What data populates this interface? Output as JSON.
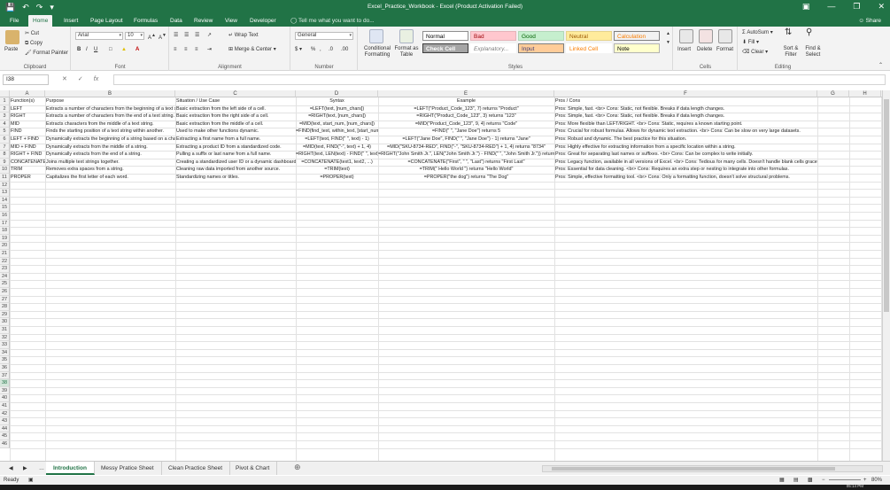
{
  "window": {
    "title": "Excel_Practice_Workbook - Excel (Product Activation Failed)",
    "share": "Share"
  },
  "tabs": [
    "File",
    "Home",
    "Insert",
    "Page Layout",
    "Formulas",
    "Data",
    "Review",
    "View",
    "Developer"
  ],
  "tell_me": "Tell me what you want to do...",
  "ribbon": {
    "clipboard": {
      "label": "Clipboard",
      "paste": "Paste",
      "cut": "Cut",
      "copy": "Copy",
      "format_painter": "Format Painter"
    },
    "font": {
      "label": "Font",
      "family": "Arial",
      "size": "10"
    },
    "alignment": {
      "label": "Alignment",
      "wrap": "Wrap Text",
      "merge": "Merge & Center"
    },
    "number": {
      "label": "Number",
      "format": "General"
    },
    "styles": {
      "label": "Styles",
      "conditional": "Conditional Formatting",
      "format_as_table": "Format as Table",
      "cells": [
        {
          "text": "Normal",
          "bg": "#ffffff",
          "fg": "#000000",
          "border": "#8f8f8f"
        },
        {
          "text": "Bad",
          "bg": "#ffc7ce",
          "fg": "#9c0006",
          "border": "#e6b3b9"
        },
        {
          "text": "Good",
          "bg": "#c6efce",
          "fg": "#006100",
          "border": "#b2d7b9"
        },
        {
          "text": "Neutral",
          "bg": "#ffeb9c",
          "fg": "#9c5700",
          "border": "#e6d38c"
        },
        {
          "text": "Calculation",
          "bg": "#f2f2f2",
          "fg": "#fa7d00",
          "border": "#7f7f7f"
        },
        {
          "text": "Check Cell",
          "bg": "#a5a5a5",
          "fg": "#ffffff",
          "border": "#3f3f3f"
        },
        {
          "text": "Explanatory...",
          "bg": "#ffffff",
          "fg": "#7f7f7f",
          "border": "#ffffff"
        },
        {
          "text": "Input",
          "bg": "#ffcc99",
          "fg": "#3f3f76",
          "border": "#7f7f7f"
        },
        {
          "text": "Linked Cell",
          "bg": "#ffffff",
          "fg": "#fa7d00",
          "border": "#ffffff"
        },
        {
          "text": "Note",
          "bg": "#ffffcc",
          "fg": "#000000",
          "border": "#b2b2b2"
        }
      ]
    },
    "cells": {
      "label": "Cells",
      "insert": "Insert",
      "delete": "Delete",
      "format": "Format"
    },
    "editing": {
      "label": "Editing",
      "autosum": "AutoSum",
      "fill": "Fill",
      "clear": "Clear",
      "sort": "Sort & Filter",
      "find": "Find & Select"
    }
  },
  "formula_bar": {
    "name_box": "I38",
    "fx": "fx",
    "value": ""
  },
  "columns": [
    "A",
    "B",
    "C",
    "D",
    "E",
    "F",
    "G",
    "H"
  ],
  "rows": [
    [
      "Function(s)",
      "Purpose",
      "Situation / Use Case",
      "Syntax",
      "Example",
      "Pros / Cons"
    ],
    [
      "LEFT",
      "Extracts a number of characters from the beginning of a text string.",
      "Basic extraction from the left side of a cell.",
      "=LEFT(text, [num_chars])",
      "=LEFT(\"Product_Code_123\", 7) returns \"Product\"",
      "Pros: Simple, fast. <br> Cons: Static, not flexible. Breaks if data length changes."
    ],
    [
      "RIGHT",
      "Extracts a number of characters from the end of a text string.",
      "Basic extraction from the right side of a cell.",
      "=RIGHT(text, [num_chars])",
      "=RIGHT(\"Product_Code_123\", 3) returns \"123\"",
      "Pros: Simple, fast. <br> Cons: Static, not flexible. Breaks if data length changes."
    ],
    [
      "MID",
      "Extracts characters from the middle of a text string.",
      "Basic extraction from the middle of a cell.",
      "=MID(text, start_num, [num_chars])",
      "=MID(\"Product_Code_123\", 9, 4) returns \"Code\"",
      "Pros: More flexible than LEFT/RIGHT. <br> Cons: Static, requires a known starting point."
    ],
    [
      "FIND",
      "Finds the starting position of a text string within another.",
      "Used to make other functions dynamic.",
      "=FIND(find_text, within_text, [start_num])",
      "=FIND(\" \", \"Jane Doe\") returns 5",
      "Pros: Crucial for robust formulas. Allows for dynamic text extraction. <br> Cons: Can be slow on very large datasets."
    ],
    [
      "LEFT + FIND",
      "Dynamically extracts the beginning of a string based on a character.",
      "Extracting a first name from a full name.",
      "=LEFT(text, FIND(\" \", text) - 1)",
      "=LEFT(\"Jane Doe\", FIND(\" \", \"Jane Doe\") - 1) returns \"Jane\"",
      "Pros: Robust and dynamic. The best practice for this situation."
    ],
    [
      "MID + FIND",
      "Dynamically extracts from the middle of a string.",
      "Extracting a product ID from a standardized code.",
      "=MID(text, FIND(\"-\", text) + 1, 4)",
      "=MID(\"SKU-8734-RED\", FIND(\"-\", \"SKU-8734-RED\") + 1, 4) returns \"8734\"",
      "Pros: Highly effective for extracting information from a specific location within a string."
    ],
    [
      "RIGHT + FIND",
      "Dynamically extracts from the end of a string.",
      "Pulling a suffix or last name from a full name.",
      "=RIGHT(text, LEN(text) - FIND(\" \", text))",
      "=RIGHT(\"John Smith Jr.\", LEN(\"John Smith Jr.\") - FIND(\" \", \"John Smith Jr.\")) returns",
      "Pros: Great for separating last names or suffixes. <br> Cons: Can be complex to write initially."
    ],
    [
      "CONCATENATE",
      "Joins multiple text strings together.",
      "Creating a standardized user ID or a dynamic dashboard title.",
      "=CONCATENATE(text1, text2, ...)",
      "=CONCATENATE(\"First\", \" \", \"Last\") returns \"First Last\"",
      "Pros: Legacy function, available in all versions of Excel. <br> Cons: Tedious for many cells. Doesn't handle blank cells gracefully."
    ],
    [
      "TRIM",
      "Removes extra spaces from a string.",
      "Cleaning raw data imported from another source.",
      "=TRIM(text)",
      "=TRIM(\"  Hello  World  \") returns \"Hello World\"",
      "Pros: Essential for data cleaning. <br> Cons: Requires an extra step or nesting to integrate into other formulas."
    ],
    [
      "PROPER",
      "Capitalizes the first letter of each word.",
      "Standardizing names or titles.",
      "=PROPER(text)",
      "=PROPER(\"the dog\") returns \"The Dog\"",
      "Pros: Simple, effective formatting tool. <br> Cons: Only a formatting function, doesn't solve structural problems."
    ]
  ],
  "row_count": 46,
  "selected_cell": {
    "col": "I",
    "row": 38
  },
  "sheets": [
    "Introduction",
    "Messy Pratice Sheet",
    "Clean Practice Sheet",
    "Pivot & Chart"
  ],
  "active_sheet": "Introduction",
  "status": {
    "ready": "Ready",
    "zoom": "80%",
    "time": "05:14 PM"
  }
}
